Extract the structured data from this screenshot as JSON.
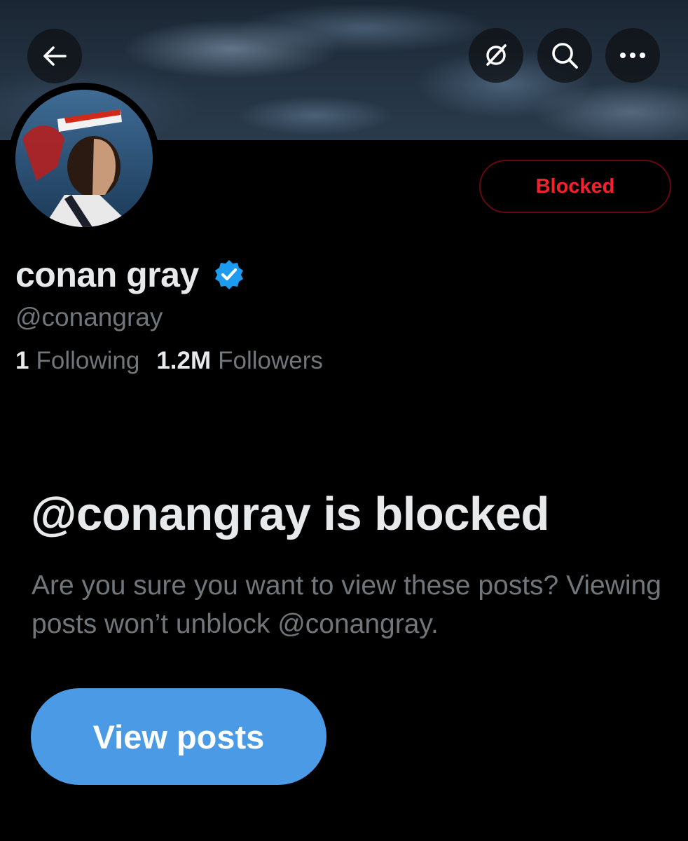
{
  "header": {
    "back_icon": "arrow-left-icon",
    "grok_icon": "grok-icon",
    "search_icon": "search-icon",
    "more_icon": "more-horizontal-icon"
  },
  "profile": {
    "display_name": "conan gray",
    "verified": true,
    "handle": "@conangray",
    "following_count": "1",
    "following_label": "Following",
    "followers_count": "1.2M",
    "followers_label": "Followers",
    "blocked_button_label": "Blocked"
  },
  "blocked_notice": {
    "title": "@conangray is blocked",
    "message": "Are you sure you want to view these posts? Viewing posts won’t unblock @conangray.",
    "button_label": "View posts"
  },
  "colors": {
    "background": "#000000",
    "blocked_red": "#f4212e",
    "view_posts_blue": "#4a9ae6",
    "verified_blue": "#1d9bf0",
    "secondary_text": "#71767b"
  }
}
